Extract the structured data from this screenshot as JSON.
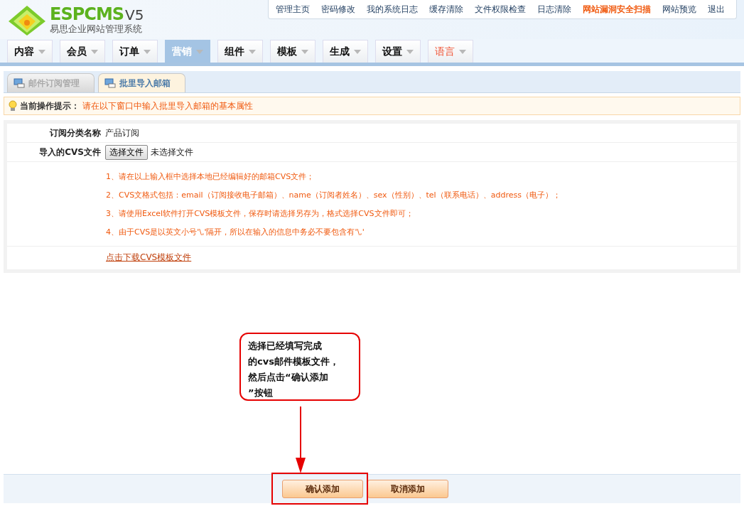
{
  "logo": {
    "brand": "ESPCMS",
    "version": "V5",
    "subtitle": "易思企业网站管理系统"
  },
  "top_links": [
    {
      "label": "管理主页",
      "highlight": false
    },
    {
      "label": "密码修改",
      "highlight": false
    },
    {
      "label": "我的系统日志",
      "highlight": false
    },
    {
      "label": "缓存清除",
      "highlight": false
    },
    {
      "label": "文件权限检查",
      "highlight": false
    },
    {
      "label": "日志清除",
      "highlight": false
    },
    {
      "label": "网站漏洞安全扫描",
      "highlight": true
    },
    {
      "label": "网站预览",
      "highlight": false
    },
    {
      "label": "退出",
      "highlight": false
    }
  ],
  "nav_tabs": [
    {
      "label": "内容",
      "selected": false,
      "highlight": false
    },
    {
      "label": "会员",
      "selected": false,
      "highlight": false
    },
    {
      "label": "订单",
      "selected": false,
      "highlight": false
    },
    {
      "label": "营销",
      "selected": true,
      "highlight": false
    },
    {
      "label": "组件",
      "selected": false,
      "highlight": false
    },
    {
      "label": "模板",
      "selected": false,
      "highlight": false
    },
    {
      "label": "生成",
      "selected": false,
      "highlight": false
    },
    {
      "label": "设置",
      "selected": false,
      "highlight": false
    },
    {
      "label": "语言",
      "selected": false,
      "highlight": true
    }
  ],
  "sub_tabs": [
    {
      "label": "邮件订阅管理",
      "selected": false
    },
    {
      "label": "批里导入邮箱",
      "selected": true
    }
  ],
  "hint": {
    "label": "当前操作提示：",
    "text": "请在以下窗口中输入批里导入邮箱的基本属性"
  },
  "form": {
    "rows": [
      {
        "label": "订阅分类名称",
        "kind": "text",
        "value": "产品订阅"
      },
      {
        "label": "导入的CVS文件",
        "kind": "file",
        "button": "选择文件",
        "value": "未选择文件"
      }
    ],
    "notes": [
      "1、请在以上输入框中选择本地已经编辑好的邮箱CVS文件；",
      "2、CVS文格式包括：email（订阅接收电子邮箱）、name（订阅者姓名）、sex（性别）、tel（联系电话）、address（电子）；",
      "3、请使用Excel软件打开CVS模板文件，保存时请选择另存为，格式选择CVS文件即可；",
      "4、由于CVS是以英文小号'\\,'隔开，所以在输入的信息中务必不要包含有'\\,'"
    ],
    "download_link": "点击下载CVS模板文件"
  },
  "buttons": [
    {
      "label": "确认添加"
    },
    {
      "label": "取消添加"
    }
  ],
  "callout": {
    "lines": [
      "选择已经填写完成",
      "的cvs邮件模板文件，",
      "然后点击“确认添加",
      "”按钮"
    ]
  }
}
